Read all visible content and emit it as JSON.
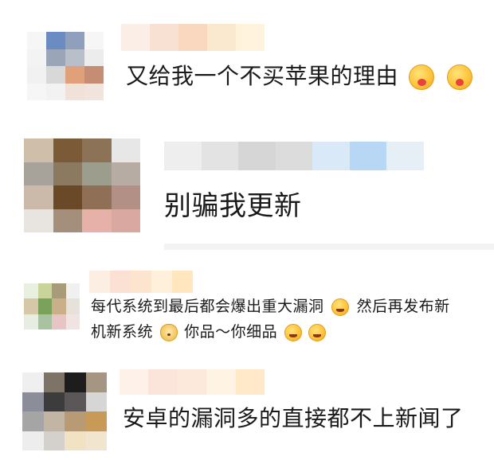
{
  "comments": [
    {
      "text": "又给我一个不买苹果的理由",
      "emojis": [
        "hug-face-icon",
        "hug-face-icon"
      ],
      "avatar_colors": [
        "#f6f6f6",
        "#6b8bc3",
        "#8fa0bc",
        "#f6f6f6",
        "#f3f3f3",
        "#9aa6b8",
        "#b8bfc9",
        "#ececec",
        "#f1f1f1",
        "#d8d8d8",
        "#e0a07a",
        "#c58d74",
        "#f6f6f6",
        "#f2f2f2",
        "#f0e2d8",
        "#f1e4dc"
      ],
      "name_colors": [
        "#fbeee6",
        "#f8e0d2",
        "#f9d8bf",
        "#fbe9cf",
        "#fff3dd"
      ]
    },
    {
      "text": "别骗我更新",
      "emojis": [],
      "avatar_colors": [
        "#cfbfaa",
        "#7a5a37",
        "#8c7256",
        "#e7e7e7",
        "#a7a39a",
        "#8b7a60",
        "#9d9d8e",
        "#b6aca4",
        "#cbb9a9",
        "#694927",
        "#8f6f55",
        "#b39086",
        "#e8e4df",
        "#a48e7c",
        "#e5b1a9",
        "#d9a8a1"
      ],
      "name_colors": [
        "#eeeeee",
        "#e3e3e3",
        "#d6d6d6",
        "#dcdcdc",
        "#d9e9f8",
        "#b7d7f4",
        "#e6eef6"
      ]
    },
    {
      "text_line1": "每代系统到最后都会爆出重大漏洞",
      "text_line1b": "然后再发布新",
      "text_line2a": "机新系统",
      "text_line2b": "你品～你细品",
      "emojis_line1": [
        "grin-sweat-icon"
      ],
      "emoji_line2a": "doge-icon",
      "emojis_line2b": [
        "tears-of-joy-icon",
        "tears-of-joy-icon"
      ],
      "avatar_colors": [
        "#eaf0e0",
        "#c9d49b",
        "#a99b7a",
        "#f0f0f0",
        "#d6c7a8",
        "#7aa25a",
        "#c9b08a",
        "#e6e2da",
        "#e7ede3",
        "#a9c2a0",
        "#e7c5c4",
        "#efe4e2"
      ],
      "name_colors": [
        "#fdeee4",
        "#fbe1d4",
        "#fde4cf",
        "#fff0dc",
        "#ffe6bf"
      ]
    },
    {
      "text": "安卓的漏洞多的直接都不上新闻了",
      "emojis": [],
      "avatar_colors": [
        "#efefef",
        "#7d7367",
        "#1d1d1d",
        "#a49682",
        "#8b8e99",
        "#3c3c3c",
        "#5b5657",
        "#d6d6d6",
        "#a5a5a5",
        "#c3b5a3",
        "#b89a74",
        "#c79a57",
        "#ededed",
        "#d4d1cc",
        "#f1e2c4",
        "#f2e5d0"
      ],
      "name_colors": [
        "#fdf1ea",
        "#fbe5da",
        "#fde9dc",
        "#fff3e4",
        "#ffe9c9"
      ]
    }
  ]
}
